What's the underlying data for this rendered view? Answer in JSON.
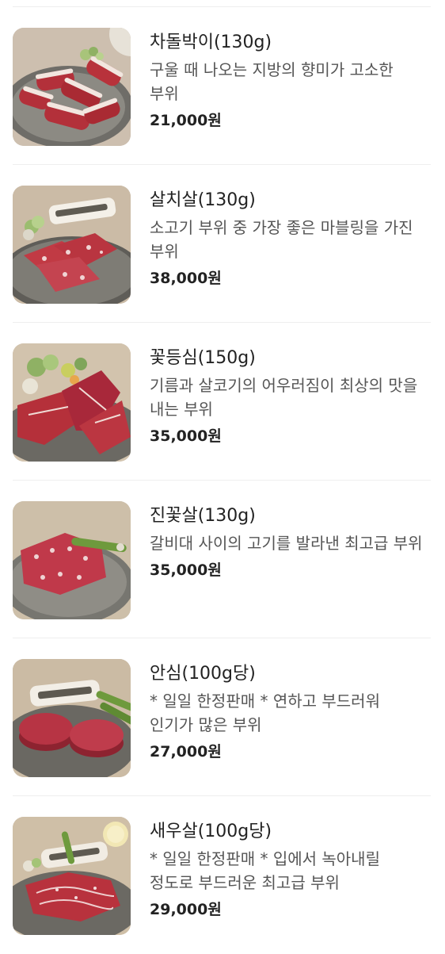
{
  "menu": {
    "items": [
      {
        "name": "차돌박이(130g)",
        "description": "구울 때 나오는 지방의 향미가 고소한 부위",
        "price": "21,000원",
        "image_icon": "beef-brisket-photo"
      },
      {
        "name": "살치살(130g)",
        "description": "소고기 부위 중 가장 좋은 마블링을 가진 부위",
        "price": "38,000원",
        "image_icon": "chuck-flap-photo"
      },
      {
        "name": "꽃등심(150g)",
        "description": "기름과 살코기의 어우러짐이 최상의 맛을 내는 부위",
        "price": "35,000원",
        "image_icon": "ribeye-photo"
      },
      {
        "name": "진꽃살(130g)",
        "description": "갈비대 사이의 고기를 발라낸 최고급 부위",
        "price": "35,000원",
        "image_icon": "intercostal-photo"
      },
      {
        "name": "안심(100g당)",
        "description": "* 일일 한정판매 * 연하고 부드러워 인기가 많은 부위",
        "price": "27,000원",
        "image_icon": "tenderloin-photo"
      },
      {
        "name": "새우살(100g당)",
        "description": "* 일일 한정판매 * 입에서 녹아내릴 정도로 부드러운 최고급 부위",
        "price": "29,000원",
        "image_icon": "ribeye-cap-photo"
      }
    ]
  },
  "colors": {
    "divider": "#eeeeee",
    "text": "#222222",
    "description": "#555555",
    "meat": "#b8323b",
    "fat": "#f3e4dc",
    "plate": "#7b7a74"
  }
}
